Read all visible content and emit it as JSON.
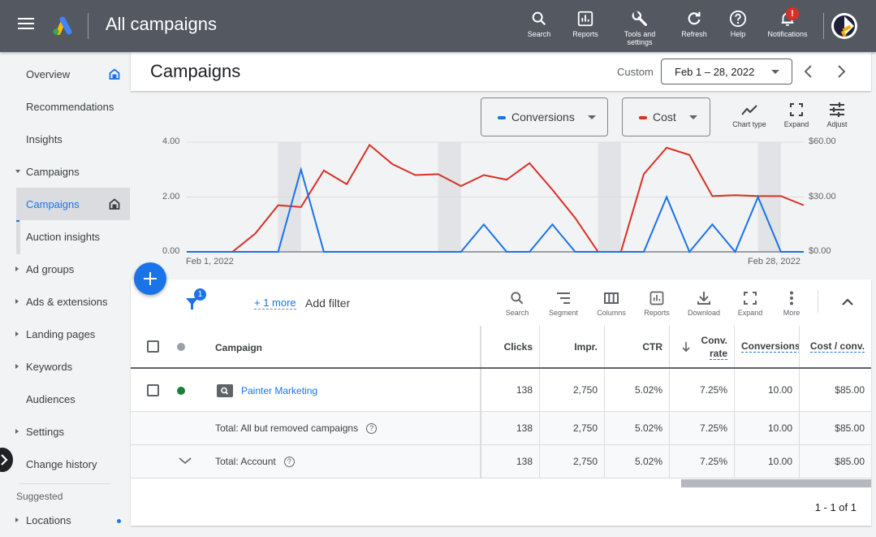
{
  "topbar": {
    "title": "All campaigns",
    "buttons": [
      {
        "icon": "search-icon",
        "label": "Search"
      },
      {
        "icon": "reports-icon",
        "label": "Reports"
      },
      {
        "icon": "wrench-icon",
        "label": "Tools and settings"
      },
      {
        "icon": "refresh-icon",
        "label": "Refresh"
      },
      {
        "icon": "help-icon",
        "label": "Help"
      },
      {
        "icon": "bell-icon",
        "label": "Notifications",
        "badge": "!"
      }
    ]
  },
  "sidebar": {
    "items": [
      {
        "label": "Overview",
        "caret": "none",
        "home": true
      },
      {
        "label": "Recommendations",
        "caret": "none"
      },
      {
        "label": "Insights",
        "caret": "none"
      },
      {
        "label": "Campaigns",
        "caret": "down"
      },
      {
        "label": "Campaigns",
        "caret": "none",
        "active": true,
        "home": true
      },
      {
        "label": "Auction insights",
        "caret": "none"
      },
      {
        "label": "Ad groups",
        "caret": "right"
      },
      {
        "label": "Ads & extensions",
        "caret": "right"
      },
      {
        "label": "Landing pages",
        "caret": "right"
      },
      {
        "label": "Keywords",
        "caret": "right"
      },
      {
        "label": "Audiences",
        "caret": "none"
      },
      {
        "label": "Settings",
        "caret": "right"
      },
      {
        "label": "Change history",
        "caret": "none"
      }
    ],
    "suggested_label": "Suggested",
    "suggested_items": [
      {
        "label": "Locations",
        "caret": "right"
      }
    ]
  },
  "header": {
    "page_title": "Campaigns",
    "date_label": "Custom",
    "date_range": "Feb 1 – 28, 2022"
  },
  "chart_controls": {
    "metric1": "Conversions",
    "metric2": "Cost",
    "tools": [
      "Chart type",
      "Expand",
      "Adjust"
    ]
  },
  "colors": {
    "conversions": "#1a73e8",
    "cost": "#d93025",
    "accent": "#1a73e8",
    "enabled_status": "#188038"
  },
  "chart_data": {
    "type": "line",
    "x_start_label": "Feb 1, 2022",
    "x_end_label": "Feb 28, 2022",
    "x": [
      "Feb 1",
      "Feb 2",
      "Feb 3",
      "Feb 4",
      "Feb 5",
      "Feb 6",
      "Feb 7",
      "Feb 8",
      "Feb 9",
      "Feb 10",
      "Feb 11",
      "Feb 12",
      "Feb 13",
      "Feb 14",
      "Feb 15",
      "Feb 16",
      "Feb 17",
      "Feb 18",
      "Feb 19",
      "Feb 20",
      "Feb 21",
      "Feb 22",
      "Feb 23",
      "Feb 24",
      "Feb 25",
      "Feb 26",
      "Feb 27",
      "Feb 28"
    ],
    "weekends": [
      [
        4,
        5
      ],
      [
        11,
        12
      ],
      [
        18,
        19
      ],
      [
        25,
        26
      ]
    ],
    "series": [
      {
        "name": "Conversions",
        "axis": "left",
        "values": [
          0,
          0,
          0,
          0,
          0,
          3,
          0,
          0,
          0,
          0,
          0,
          0,
          0,
          1,
          0,
          0,
          1,
          0,
          0,
          0,
          0,
          2,
          0,
          1,
          0,
          2,
          0,
          0
        ]
      },
      {
        "name": "Cost",
        "axis": "right",
        "values": [
          0,
          0,
          0,
          10,
          25.5,
          24.5,
          44.5,
          37,
          58.5,
          48,
          42,
          42.5,
          36,
          42,
          39.5,
          48.5,
          34,
          18.5,
          0,
          0,
          42.5,
          57,
          53,
          30.5,
          31,
          30.5,
          30.5,
          25.5
        ]
      }
    ],
    "left_axis": {
      "ticks": [
        "0.00",
        "2.00",
        "4.00"
      ],
      "range": [
        0,
        4
      ]
    },
    "right_axis": {
      "ticks": [
        "$0.00",
        "$30.00",
        "$60.00"
      ],
      "range": [
        0,
        60
      ]
    },
    "grid": true
  },
  "table_toolbar": {
    "filter_count": "1",
    "more_filters": "+ 1 more",
    "add_filter": "Add filter",
    "tools": [
      "Search",
      "Segment",
      "Columns",
      "Reports",
      "Download",
      "Expand",
      "More"
    ]
  },
  "table": {
    "headers": {
      "campaign": "Campaign",
      "clicks": "Clicks",
      "impr": "Impr.",
      "ctr": "CTR",
      "conv_rate_1": "Conv.",
      "conv_rate_2": "rate",
      "conversions": "Conversions",
      "cost_conv": "Cost / conv."
    },
    "rows": [
      {
        "campaign": "Painter Marketing",
        "clicks": "138",
        "impr": "2,750",
        "ctr": "5.02%",
        "conv_rate": "7.25%",
        "conversions": "10.00",
        "cost_conv": "$85.00"
      },
      {
        "campaign": "Total: All but removed campaigns",
        "clicks": "138",
        "impr": "2,750",
        "ctr": "5.02%",
        "conv_rate": "7.25%",
        "conversions": "10.00",
        "cost_conv": "$85.00"
      },
      {
        "campaign": "Total: Account",
        "clicks": "138",
        "impr": "2,750",
        "ctr": "5.02%",
        "conv_rate": "7.25%",
        "conversions": "10.00",
        "cost_conv": "$85.00"
      }
    ],
    "pagination": "1 - 1 of 1"
  }
}
